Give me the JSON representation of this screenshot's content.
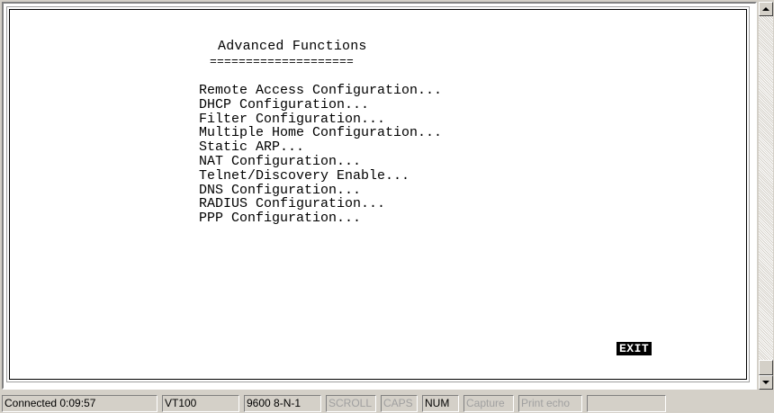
{
  "terminal": {
    "title": "Advanced Functions",
    "title_underline": "====================",
    "menu": [
      "Remote Access Configuration...",
      "DHCP Configuration...",
      "Filter Configuration...",
      "Multiple Home Configuration...",
      "Static ARP...",
      "NAT Configuration...",
      "Telnet/Discovery Enable...",
      "DNS Configuration...",
      "RADIUS Configuration...",
      "PPP Configuration..."
    ],
    "exit_label": "EXIT"
  },
  "scrollbar": {
    "up_icon": "arrow-up-icon",
    "down_icon": "arrow-down-icon"
  },
  "statusbar": {
    "connected": "Connected 0:09:57",
    "emulation": "VT100",
    "port_settings": "9600 8-N-1",
    "scroll": "SCROLL",
    "caps": "CAPS",
    "num": "NUM",
    "capture": "Capture",
    "print_echo": "Print echo",
    "extra": ""
  },
  "colors": {
    "terminal_bg": "#ffffff",
    "terminal_fg": "#000000",
    "chrome": "#d4d0c8",
    "dim_text": "#a0a0a0"
  }
}
